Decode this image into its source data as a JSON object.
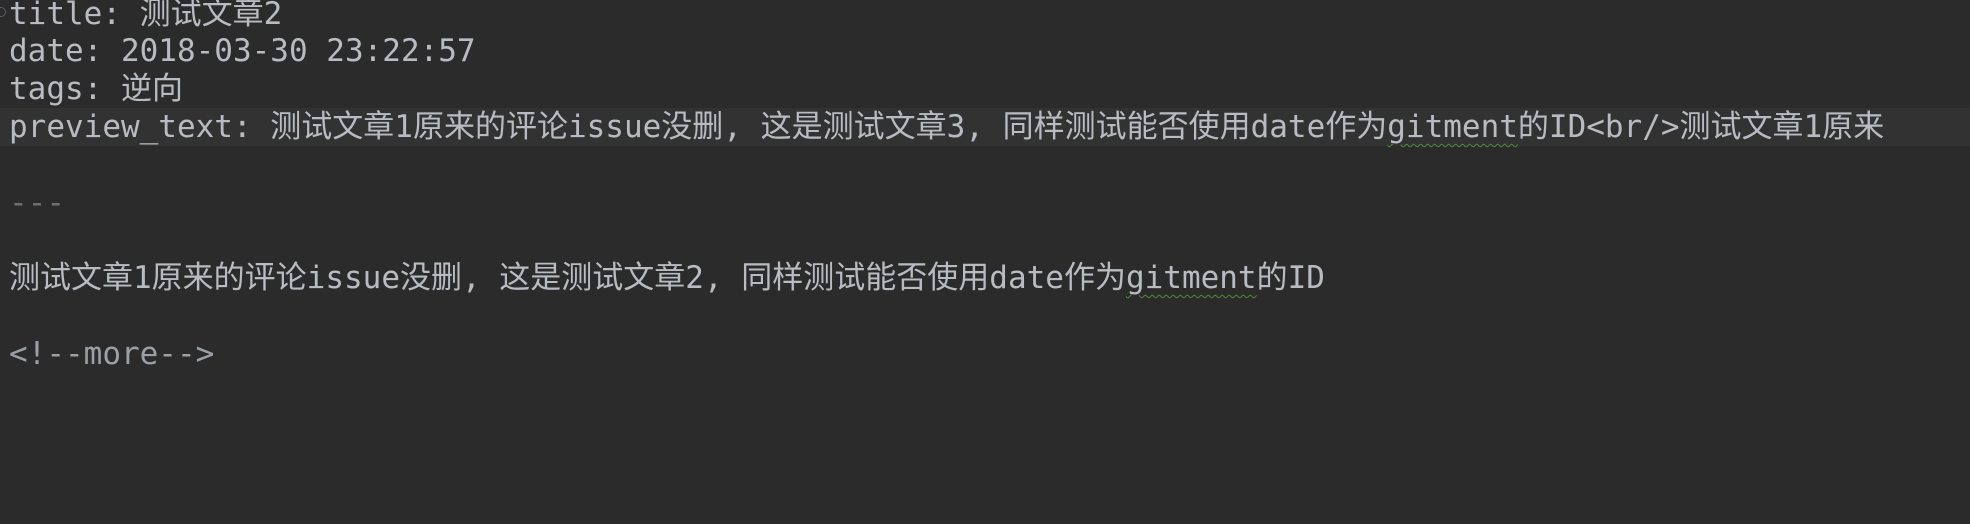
{
  "editor": {
    "lines": [
      {
        "key": "title: ",
        "value": "测试文章2"
      },
      {
        "key": "date: ",
        "value": "2018-03-30 23:22:57"
      },
      {
        "key": "tags: ",
        "value": "逆向"
      },
      {
        "key": "preview_text: ",
        "value_before": "测试文章1原来的评论issue没删, 这是测试文章3, 同样测试能否使用date作为",
        "value_word": "gitment",
        "value_after": "的ID<br/>测试文章1原来"
      }
    ],
    "separator": "---",
    "body": {
      "before": "测试文章1原来的评论issue没删, 这是测试文章2, 同样测试能否使用date作为",
      "word": "gitment",
      "after": "的ID"
    },
    "more_tag": "<!--more-->"
  }
}
